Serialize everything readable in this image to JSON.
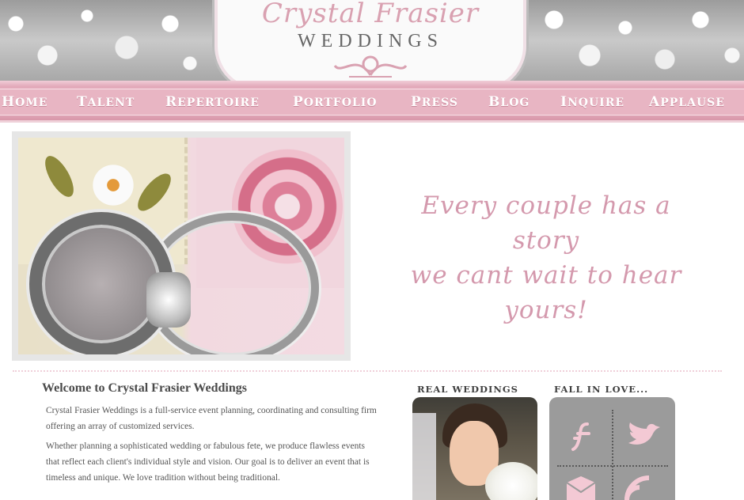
{
  "header": {
    "logo_script": "Crystal Frasier",
    "logo_word": "WEDDINGS"
  },
  "nav": {
    "items": [
      "Home",
      "Talent",
      "Repertoire",
      "Portfolio",
      "Press",
      "Blog",
      "Inquire",
      "Applause"
    ]
  },
  "hero": {
    "tagline_line1": "Every couple has a story",
    "tagline_line2": "we cant wait to hear",
    "tagline_line3": "yours!"
  },
  "welcome": {
    "title": "Welcome to Crystal Frasier Weddings",
    "p1": "Crystal Frasier Weddings is a full-service event planning, coordinating and consulting firm offering an array of customized services.",
    "p2": "Whether planning a sophisticated wedding or fabulous fete, we produce flawless events that reflect each client's individual style and vision. Our goal is to deliver an event that is timeless and unique. We love tradition without being traditional."
  },
  "sidebar": {
    "real_weddings": "Real Weddings",
    "fall_in_love": "Fall in Love..."
  },
  "social": {
    "icons": [
      "facebook-icon",
      "twitter-icon",
      "email-icon",
      "rss-icon"
    ]
  },
  "colors": {
    "accent_pink": "#e8b5c3",
    "tagline_pink": "#d499ad",
    "social_gray": "#9b9b9b"
  }
}
